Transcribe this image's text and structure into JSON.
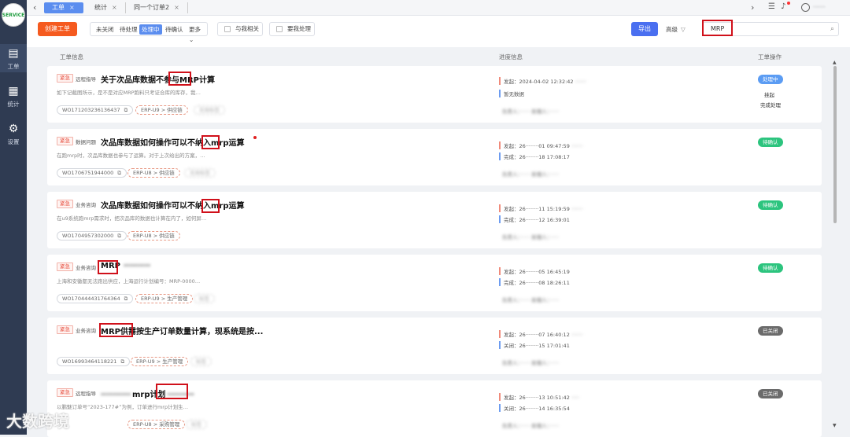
{
  "app": {
    "logo_text": "SERVICE"
  },
  "sidebar": {
    "items": [
      {
        "label": "工单",
        "icon": "ticket-icon"
      },
      {
        "label": "统计",
        "icon": "grid-icon"
      },
      {
        "label": "设置",
        "icon": "gear-icon"
      }
    ]
  },
  "tabs": [
    {
      "label": "工单",
      "close": "×"
    },
    {
      "label": "统计",
      "close": "×"
    },
    {
      "label": "同一个订单2",
      "close": "×"
    }
  ],
  "topbar": {
    "username": "·······"
  },
  "toolbar": {
    "create": "创建工单",
    "filters": [
      "未关闭",
      "待处理",
      "处理中",
      "待确认",
      "更多"
    ],
    "more_arrow": "⌄",
    "related": "与我相关",
    "mine": "要我处理",
    "export": "导出",
    "advanced": "高级",
    "search_value": "MRP"
  },
  "columns": {
    "info": "工单信息",
    "progress": "进度信息",
    "ops": "工单操作"
  },
  "tickets": [
    {
      "tag": "紧急",
      "category": "远程指导",
      "title": "关于次品库数据不参与MRP计算",
      "desc": "如下记截图所示，是不是对应MRP跑料只考证合库的库存，我…",
      "wo": "WO171203236136437",
      "erp": "ERP-U9 > 供应链",
      "extra": "无效标签",
      "line1": "发起：2024-04-02 12:32:42",
      "line1_extra": "·······",
      "line2": "暂无数据",
      "people": "负责人：······    处理人：······",
      "status": "处理中",
      "status_type": "proc",
      "actions": [
        "挂起",
        "完成处理"
      ]
    },
    {
      "tag": "紧急",
      "category": "数据问题",
      "title": "次品库数据如何操作可以不纳入mrp运算",
      "desc": "在跑mrp时，次品库数据也参与了运算。对于上次给出的方案，…",
      "wo": "WO1706751944000",
      "erp": "ERP-U8 > 供应链",
      "extra": "无效标签",
      "line1": "发起：26········01 09:47:59",
      "line1_extra": "·······",
      "line2": "完成：26········18 17:08:17",
      "people": "负责人：······    处理人：······",
      "status": "待确认",
      "status_type": "wait",
      "actions": []
    },
    {
      "tag": "紧急",
      "category": "业务咨询",
      "title": "次品库数据如何操作可以不纳入mrp运算",
      "desc": "在u9系统跑mrp需求时，把次品库的数据也计算在内了，如何屏…",
      "wo": "WO1704957302000",
      "erp": "ERP-U8 > 供应链",
      "extra": "",
      "line1": "发起：26········11 15:19:59",
      "line1_extra": "·······",
      "line2": "完成：26········12 16:39:01",
      "people": "负责人：······    处理人：······",
      "status": "待确认",
      "status_type": "wait",
      "actions": []
    },
    {
      "tag": "紧急",
      "category": "业务咨询",
      "title": "MRP",
      "title_hidden": "·········",
      "desc": "上海和安徽都无法跑出供应，上海运行计划编号：MRP-0000…",
      "wo": "WO170444431764364",
      "erp": "ERP-U9 > 生产管理",
      "extra": "标签",
      "line1": "发起：26········05 16:45:19",
      "line1_extra": "",
      "line2": "完成：26········08 18:26:11",
      "people": "负责人：······    处理人：······",
      "status": "待确认",
      "status_type": "wait",
      "actions": []
    },
    {
      "tag": "紧急",
      "category": "业务咨询",
      "title": "MRP供需按生产订单数量计算，现系统是按...",
      "desc": "",
      "wo": "WO16993464118221",
      "erp": "ERP-U9 > 生产管理",
      "extra": "标签",
      "line1": "发起：26········07 16:40:12",
      "line1_extra": "·······",
      "line2": "关闭：26········15 17:01:41",
      "people": "负责人：······    处理人：······",
      "status": "已关闭",
      "status_type": "closed",
      "actions": []
    },
    {
      "tag": "紧急",
      "category": "远程指导",
      "title": "mrp计划",
      "title_hidden_prefix": "··········",
      "title_hidden_suffix": "·········",
      "desc": "以鹏魅订单号“2023-177#”为例，订单进行mrp计划生…",
      "wo": "",
      "erp": "ERP-U8 > 采购管理",
      "extra": "标签",
      "line1": "发起：26········13 10:51:42",
      "line1_extra": "·····",
      "line2": "关闭：26········14 16:35:54",
      "people": "负责人：······    处理人：······",
      "status": "已关闭",
      "status_type": "closed",
      "actions": []
    }
  ],
  "watermark": "大数跨境",
  "colors": {
    "accent": "#5b8def",
    "create": "#f55a1f",
    "export": "#4a6ff0",
    "highlight": "#d0101a",
    "wait": "#2cc47e",
    "closed": "#6b6b6b",
    "proc": "#5b9cf3"
  }
}
